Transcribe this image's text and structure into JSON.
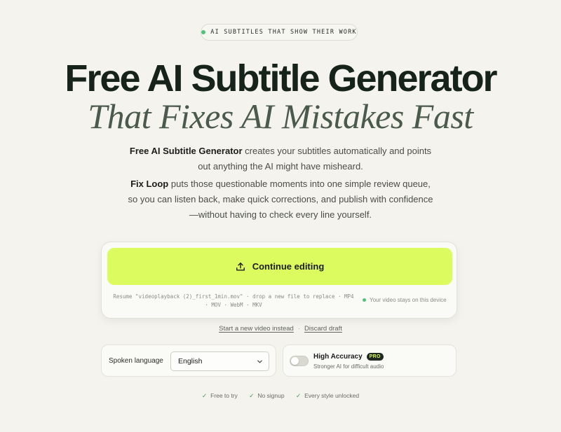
{
  "pill": {
    "text": "AI SUBTITLES THAT SHOW THEIR WORK"
  },
  "hero": {
    "title": "Free AI Subtitle Generator",
    "subtitle": "That Fixes AI Mistakes Fast"
  },
  "description": {
    "p1_bold": "Free AI Subtitle Generator",
    "p1_rest": " creates your subtitles automatically and points out anything the AI might have misheard.",
    "p2_bold": "Fix Loop",
    "p2_rest": " puts those questionable moments into one simple review queue, so you can listen back, make quick corrections, and publish with confidence—without having to check every line yourself."
  },
  "upload": {
    "cta_label": "Continue editing",
    "resume_text": "Resume \"videoplayback (2)_first_1min.mov\" · drop a new file to replace · MP4 · MOV · WebM · MKV",
    "device_note": "Your video stays on this device"
  },
  "links": {
    "new_video": "Start a new video instead",
    "separator": "·",
    "discard": "Discard draft"
  },
  "language": {
    "label": "Spoken language",
    "selected": "English"
  },
  "accuracy": {
    "title": "High Accuracy",
    "badge": "PRO",
    "subtitle": "Stronger AI for difficult audio",
    "enabled": false
  },
  "features": [
    {
      "icon": "check-icon",
      "text": "Free to try"
    },
    {
      "icon": "check-icon",
      "text": "No signup"
    },
    {
      "icon": "check-icon",
      "text": "Every style unlocked"
    }
  ],
  "colors": {
    "background": "#f4f3ed",
    "accent": "#dcfb5e",
    "status_dot": "#4fc37a"
  }
}
